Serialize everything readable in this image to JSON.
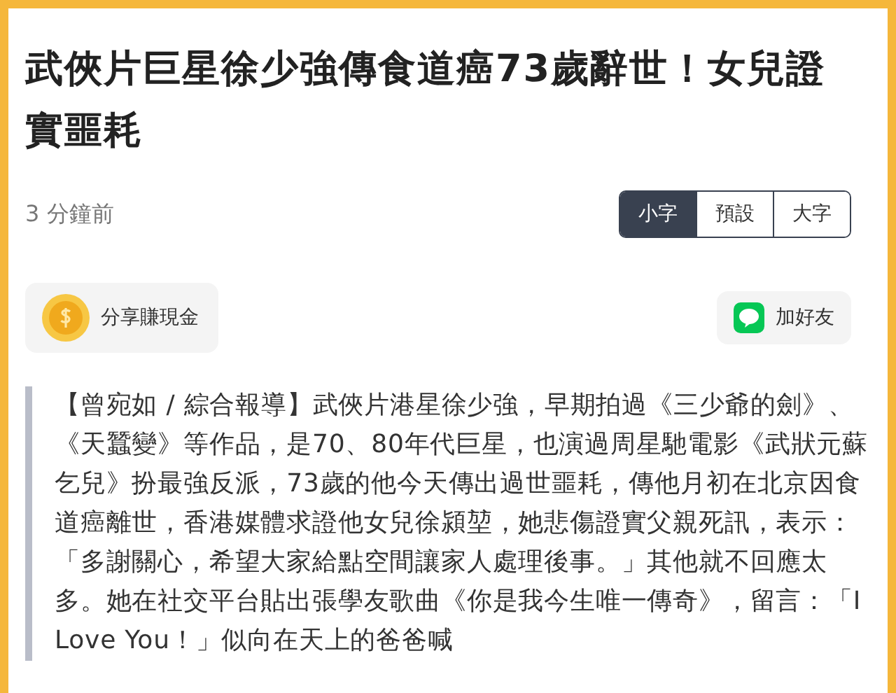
{
  "article": {
    "title": "武俠片巨星徐少強傳食道癌73歲辭世！女兒證實噩耗",
    "time": "3 分鐘前"
  },
  "font_sizes": [
    {
      "label": "小字",
      "selected": true
    },
    {
      "label": "預設",
      "selected": false
    },
    {
      "label": "大字",
      "selected": false
    }
  ],
  "actions": [
    {
      "kind": "coin",
      "label": "分享賺現金"
    },
    {
      "kind": "line",
      "label": "加好友"
    }
  ],
  "body": "【曾宛如 / 綜合報導】武俠片港星徐少強，早期拍過《三少爺的劍》、《天蠶變》等作品，是70、80年代巨星，也演過周星馳電影《武狀元蘇乞兒》扮最強反派，73歲的他今天傳出過世噩耗，傳他月初在北京因食道癌離世，香港媒體求證他女兒徐潁堃，她悲傷證實父親死訊，表示：「多謝關心，希望大家給點空間讓家人處理後事。」其他就不回應太多。她在社交平台貼出張學友歌曲《你是我今生唯一傳奇》，留言：「I Love You！」似向在天上的爸爸喊"
}
